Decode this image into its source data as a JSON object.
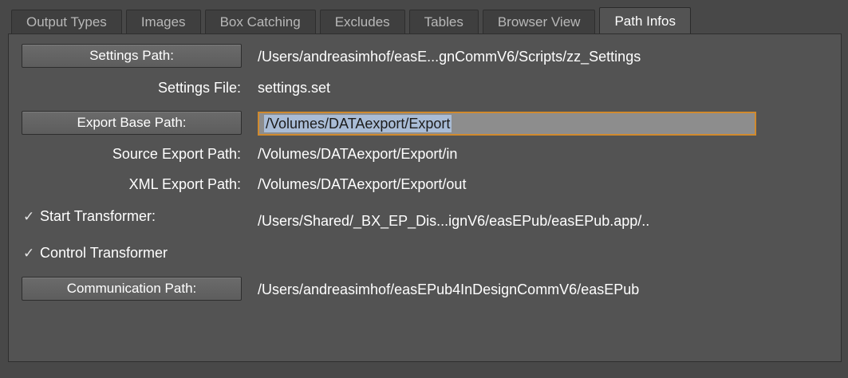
{
  "tabs": [
    {
      "label": "Output Types",
      "active": false
    },
    {
      "label": "Images",
      "active": false
    },
    {
      "label": "Box Catching",
      "active": false
    },
    {
      "label": "Excludes",
      "active": false
    },
    {
      "label": "Tables",
      "active": false
    },
    {
      "label": "Browser View",
      "active": false
    },
    {
      "label": "Path Infos",
      "active": true
    }
  ],
  "settings_path": {
    "button_label": "Settings Path:",
    "value": "/Users/andreasimhof/easE...gnCommV6/Scripts/zz_Settings"
  },
  "settings_file": {
    "label": "Settings File:",
    "value": "settings.set"
  },
  "export_base_path": {
    "button_label": "Export Base Path:",
    "value": "/Volumes/DATAexport/Export",
    "focused": true,
    "selected": true
  },
  "source_export_path": {
    "label": "Source Export Path:",
    "value": "/Volumes/DATAexport/Export/in"
  },
  "xml_export_path": {
    "label": "XML Export Path:",
    "value": "/Volumes/DATAexport/Export/out"
  },
  "start_transformer": {
    "checked": true,
    "check_glyph": "✓",
    "label": "Start Transformer:",
    "value": "/Users/Shared/_BX_EP_Dis...ignV6/easEPub/easEPub.app/.."
  },
  "control_transformer": {
    "checked": true,
    "check_glyph": "✓",
    "label": "Control Transformer"
  },
  "communication_path": {
    "button_label": "Communication Path:",
    "value": "/Users/andreasimhof/easEPub4InDesignCommV6/easEPub"
  },
  "colors": {
    "focus_ring": "#d08a2e",
    "selection": "#a9bcd6"
  }
}
